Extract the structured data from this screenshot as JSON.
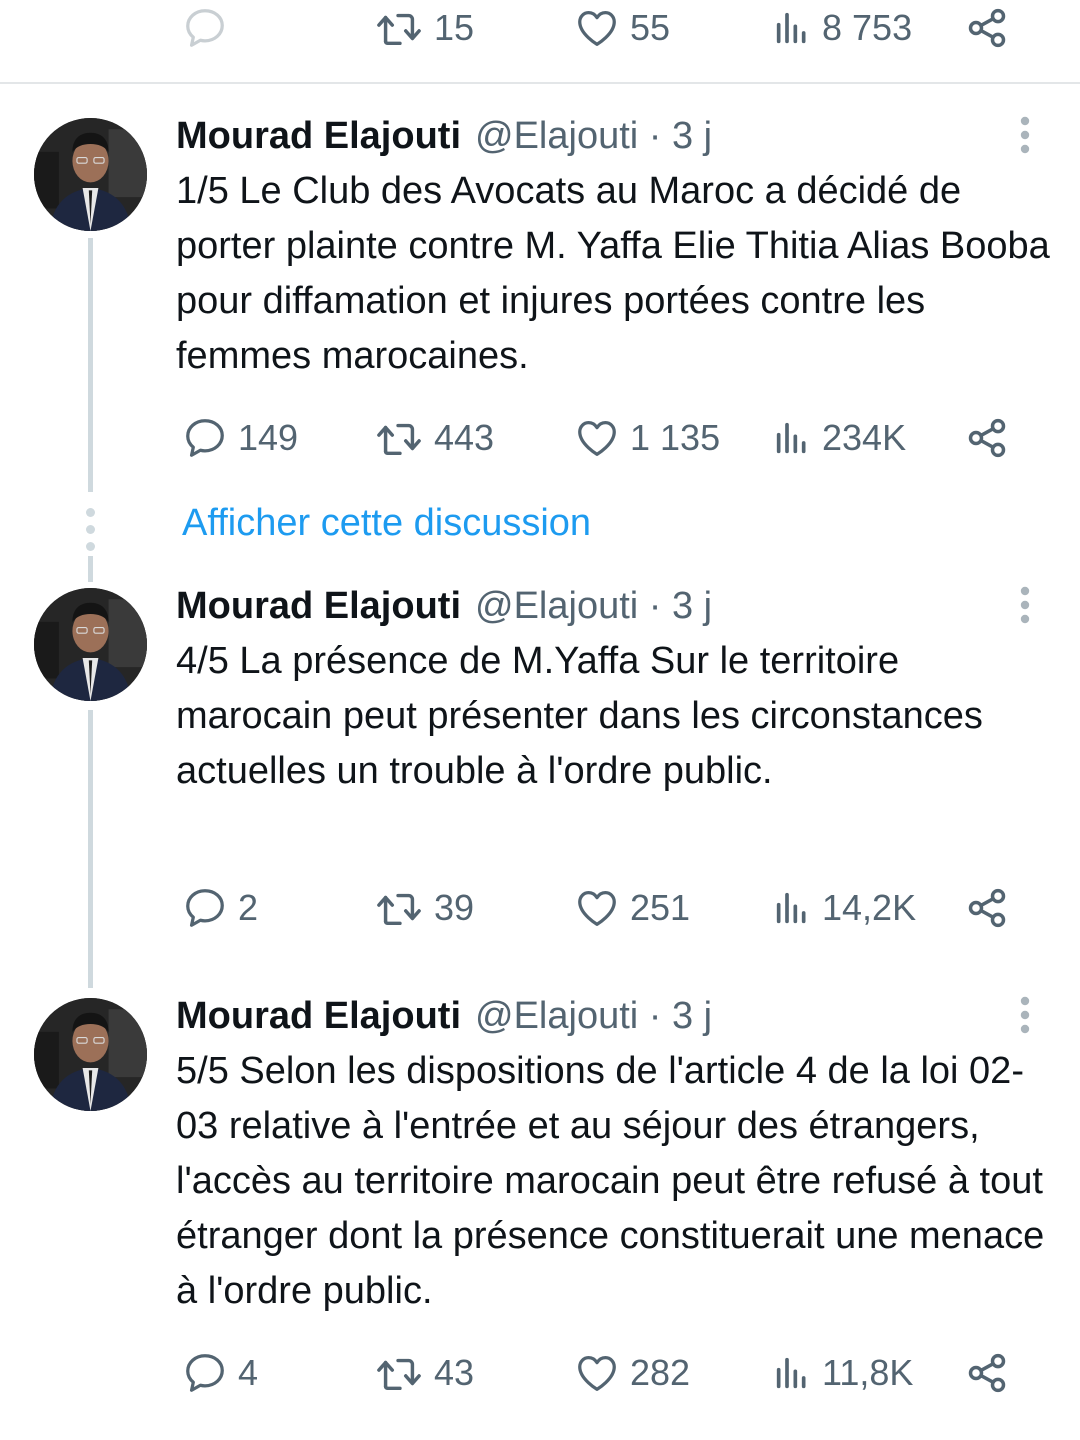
{
  "top_actions": {
    "replies": "",
    "retweets": "15",
    "likes": "55",
    "views": "8 753"
  },
  "show_thread_label": "Afficher cette discussion",
  "tweets": [
    {
      "author": "Mourad Elajouti",
      "handle_time": "@Elajouti · 3 j",
      "text": "1/5 Le Club des Avocats au Maroc a décidé de porter plainte contre M. Yaffa Elie Thitia Alias Booba pour diffamation et injures portées contre les femmes marocaines.",
      "replies": "149",
      "retweets": "443",
      "likes": "1 135",
      "views": "234K"
    },
    {
      "author": "Mourad Elajouti",
      "handle_time": "@Elajouti · 3 j",
      "text": "4/5 La présence de M.Yaffa Sur le territoire marocain peut présenter dans les circonstances actuelles un trouble à l'ordre public.",
      "replies": "2",
      "retweets": "39",
      "likes": "251",
      "views": "14,2K"
    },
    {
      "author": "Mourad Elajouti",
      "handle_time": "@Elajouti · 3 j",
      "text": "5/5 Selon les dispositions de l'article 4 de la loi 02-03 relative à l'entrée et au séjour des étrangers, l'accès au territoire marocain peut être refusé à tout étranger dont la présence constituerait une menace à l'ordre public.",
      "replies": "4",
      "retweets": "43",
      "likes": "282",
      "views": "11,8K"
    }
  ],
  "icons": {
    "reply": "reply-icon",
    "retweet": "retweet-icon",
    "like": "heart-icon",
    "views": "views-icon",
    "share": "share-icon",
    "more": "more-icon"
  },
  "colors": {
    "accent": "#1d9bf0",
    "text": "#0f1419",
    "muted": "#536471",
    "thread_line": "#cfd9de"
  }
}
